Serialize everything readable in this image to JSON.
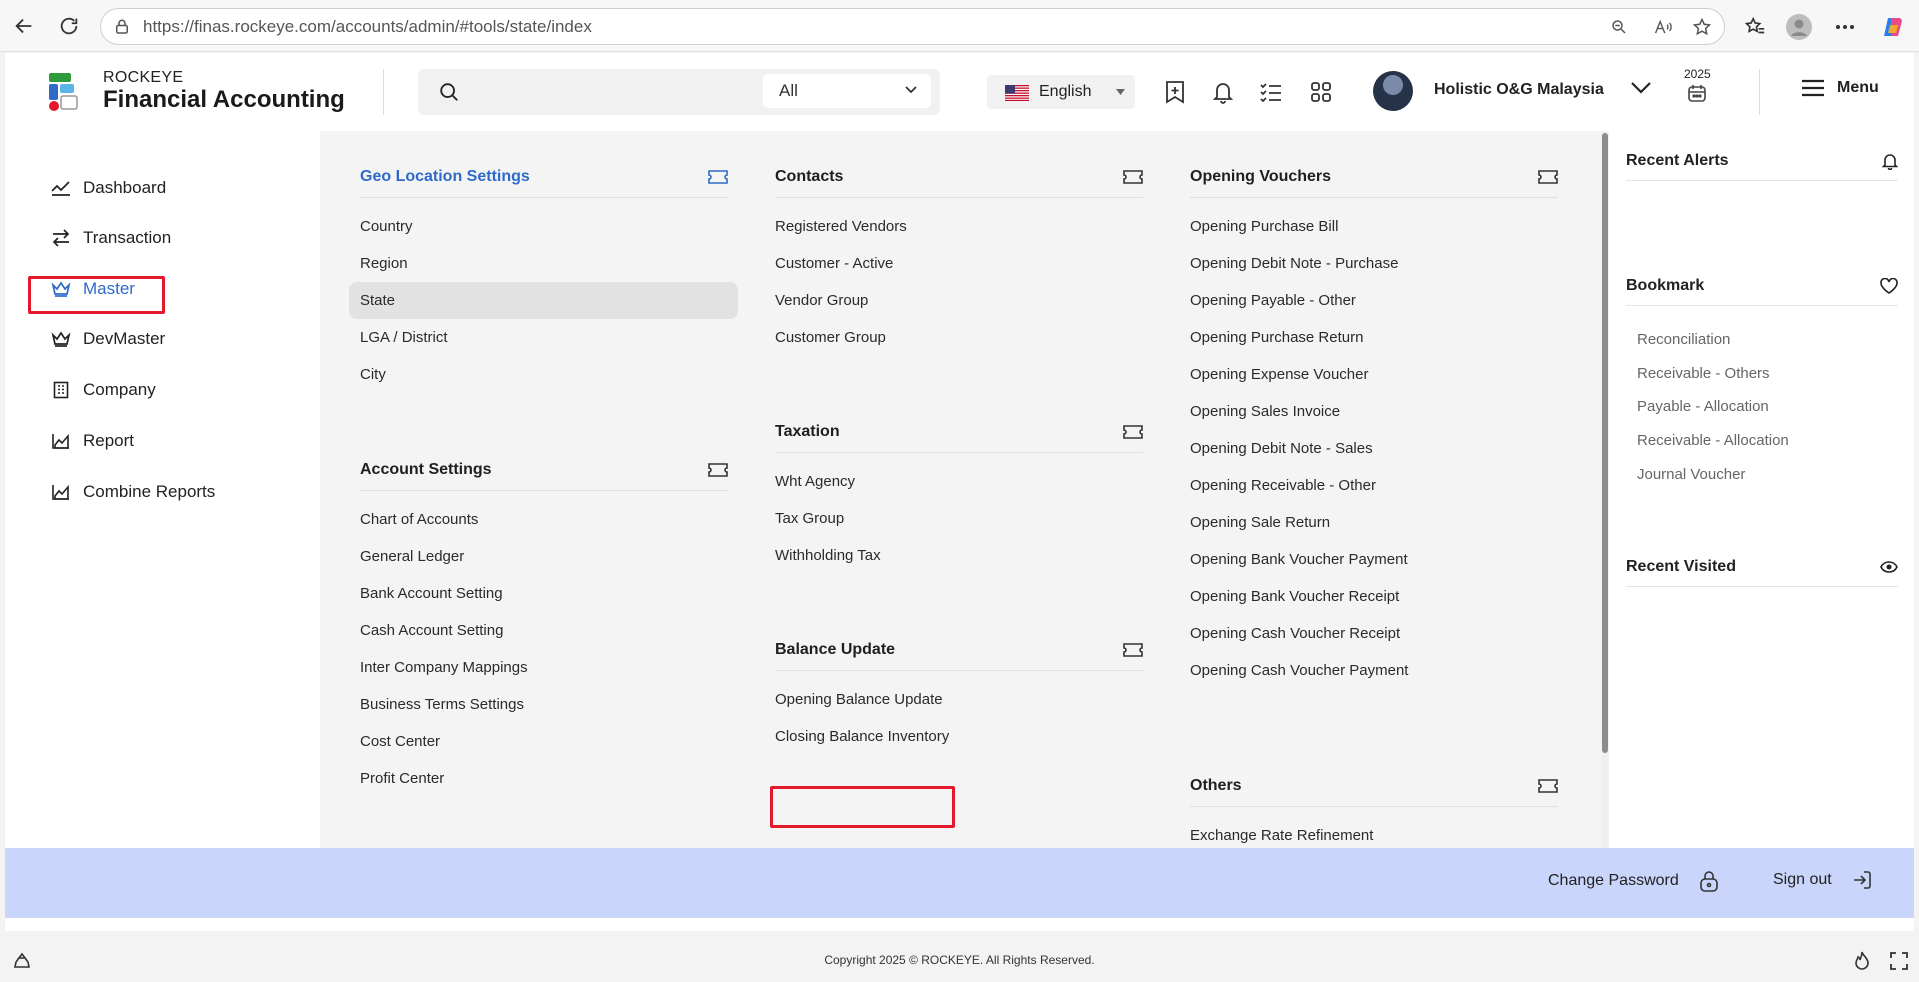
{
  "browser": {
    "url": "https://finas.rockeye.com/accounts/admin/#tools/state/index"
  },
  "header": {
    "brand_top": "ROCKEYE",
    "brand_main": "Financial Accounting",
    "search_placeholder": "",
    "search_scope": "All",
    "language": "English",
    "company": "Holistic O&G Malaysia",
    "year": "2025",
    "menu_label": "Menu"
  },
  "left_nav": {
    "items": [
      {
        "label": "Dashboard",
        "icon": "chart-line-icon"
      },
      {
        "label": "Transaction",
        "icon": "arrows-exchange-icon"
      },
      {
        "label": "Master",
        "icon": "crown-icon"
      },
      {
        "label": "DevMaster",
        "icon": "crown-icon"
      },
      {
        "label": "Company",
        "icon": "building-icon"
      },
      {
        "label": "Report",
        "icon": "area-chart-icon"
      },
      {
        "label": "Combine Reports",
        "icon": "area-chart-icon"
      }
    ],
    "active": "Master"
  },
  "mega_menu": {
    "geo": {
      "title": "Geo Location Settings",
      "items": [
        "Country",
        "Region",
        "State",
        "LGA / District",
        "City"
      ],
      "selected": "State"
    },
    "account": {
      "title": "Account Settings",
      "items": [
        "Chart of Accounts",
        "General Ledger",
        "Bank Account Setting",
        "Cash Account Setting",
        "Inter Company Mappings",
        "Business Terms Settings",
        "Cost Center",
        "Profit Center"
      ]
    },
    "contacts": {
      "title": "Contacts",
      "items": [
        "Registered Vendors",
        "Customer - Active",
        "Vendor Group",
        "Customer Group"
      ]
    },
    "taxation": {
      "title": "Taxation",
      "items": [
        "Wht Agency",
        "Tax Group",
        "Withholding Tax"
      ]
    },
    "balance": {
      "title": "Balance Update",
      "items": [
        "Opening Balance Update",
        "Closing Balance Inventory"
      ]
    },
    "opening": {
      "title": "Opening Vouchers",
      "items": [
        "Opening Purchase Bill",
        "Opening Debit Note - Purchase",
        "Opening Payable - Other",
        "Opening Purchase Return",
        "Opening Expense Voucher",
        "Opening Sales Invoice",
        "Opening Debit Note - Sales",
        "Opening Receivable - Other",
        "Opening Sale Return",
        "Opening Bank Voucher Payment",
        "Opening Bank Voucher Receipt",
        "Opening Cash Voucher Receipt",
        "Opening Cash Voucher Payment"
      ]
    },
    "others": {
      "title": "Others",
      "items": [
        "Exchange Rate Refinement"
      ]
    }
  },
  "right_panel": {
    "alerts_title": "Recent Alerts",
    "bookmark_title": "Bookmark",
    "bookmarks": [
      "Reconciliation",
      "Receivable - Others",
      "Payable - Allocation",
      "Receivable - Allocation",
      "Journal Voucher"
    ],
    "visited_title": "Recent Visited"
  },
  "footer": {
    "change_password": "Change Password",
    "sign_out": "Sign out",
    "copyright": "Copyright 2025 © ROCKEYE. All Rights Reserved."
  },
  "colors": {
    "accent": "#2f6ac9",
    "highlight_box": "#e5172a",
    "action_bar": "#c9d5fb"
  }
}
